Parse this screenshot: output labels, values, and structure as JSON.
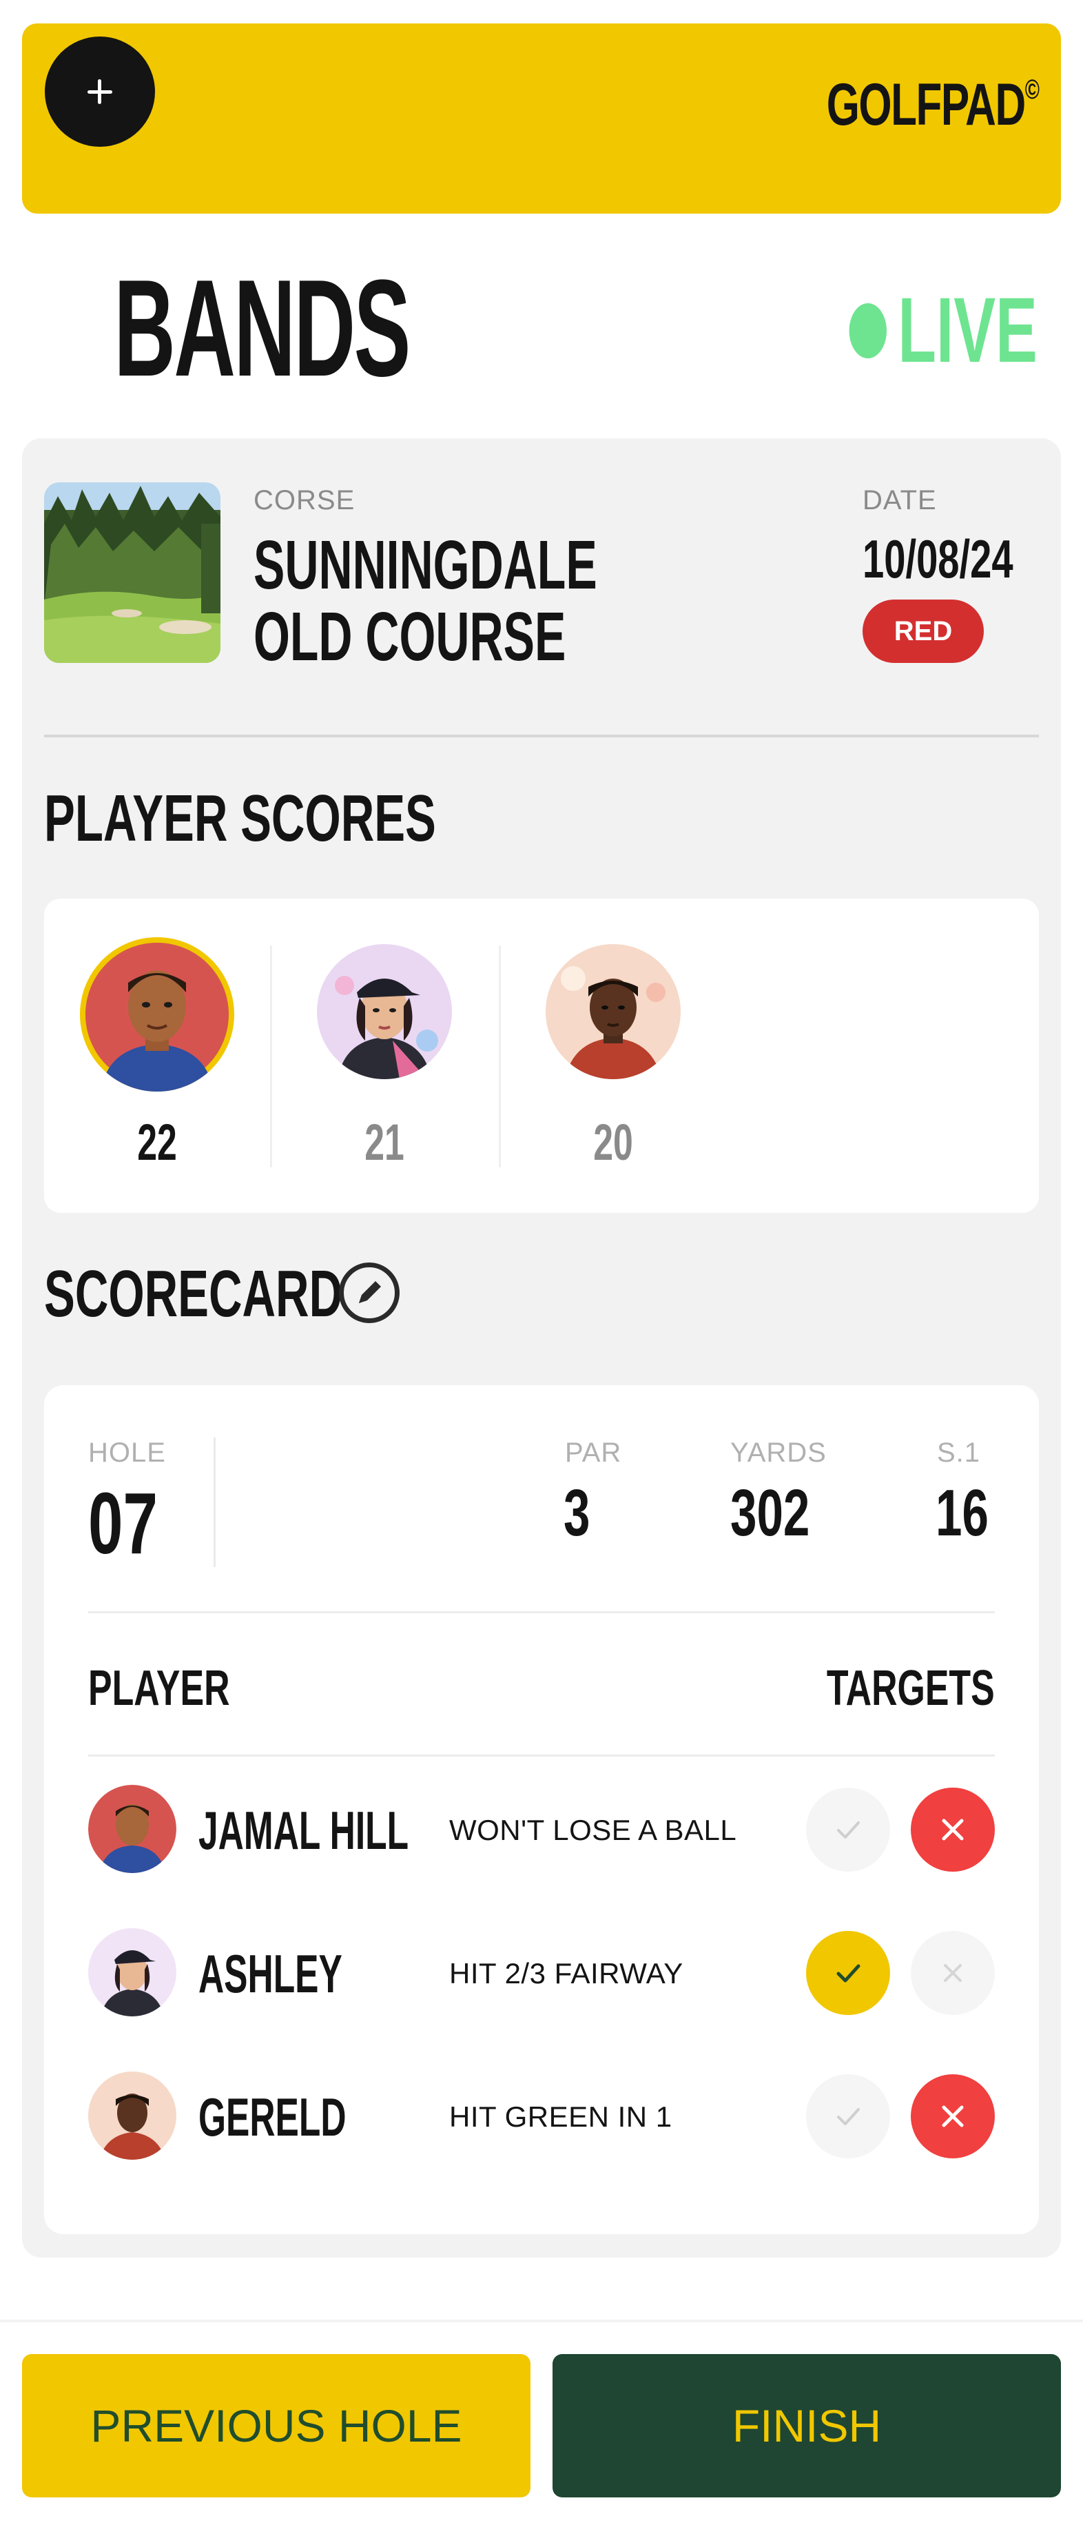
{
  "header": {
    "brand": "GOLFPAD",
    "brand_mark": "©",
    "add_icon": "plus-icon"
  },
  "page": {
    "title": "BANDS",
    "status": "LIVE",
    "status_color": "#6ee491"
  },
  "course": {
    "course_label": "CORSE",
    "course_name_line1": "SUNNINGDALE",
    "course_name_line2": "OLD COURSE",
    "date_label": "DATE",
    "date": "10/08/24",
    "tee": "RED",
    "tee_color": "#d42f2f"
  },
  "player_scores": {
    "title": "PLAYER SCORES",
    "players": [
      {
        "score": "22",
        "highlighted": true
      },
      {
        "score": "21",
        "highlighted": false
      },
      {
        "score": "20",
        "highlighted": false
      }
    ]
  },
  "scorecard": {
    "title": "SCORECARD",
    "edit_icon": "pencil-icon",
    "hole_label": "HOLE",
    "hole": "07",
    "par_label": "PAR",
    "par": "3",
    "yards_label": "YARDS",
    "yards": "302",
    "si_label": "S.1",
    "si": "16",
    "col_player": "PLAYER",
    "col_targets": "TARGETS",
    "rows": [
      {
        "name": "JAMAL HILL",
        "target": "WON'T LOSE A BALL",
        "hit": false,
        "missed": true
      },
      {
        "name": "ASHLEY",
        "target": "HIT 2/3  FAIRWAY",
        "hit": true,
        "missed": false
      },
      {
        "name": "GERELD",
        "target": "HIT GREEN IN 1",
        "hit": false,
        "missed": true
      }
    ]
  },
  "footer": {
    "previous_label": "PREVIOUS HOLE",
    "finish_label": "FINISH"
  },
  "colors": {
    "accent_yellow": "#f1c700",
    "dark_green": "#1e4632",
    "miss_red": "#f0403f"
  }
}
